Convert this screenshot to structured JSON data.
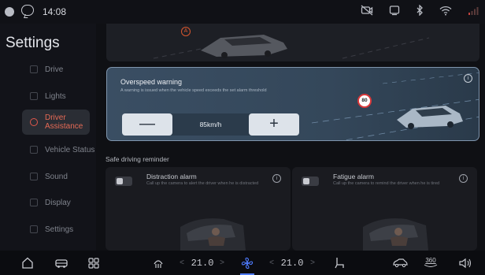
{
  "status_bar": {
    "time": "14:08",
    "icons": [
      "profile-icon",
      "message-icon",
      "camera-off-icon",
      "screen-icon",
      "bluetooth-icon",
      "wifi-icon",
      "signal-icon"
    ]
  },
  "sidebar": {
    "title": "Settings",
    "items": [
      {
        "label": "Drive",
        "active": false
      },
      {
        "label": "Lights",
        "active": false
      },
      {
        "label": "Driver\nAssistance",
        "active": true
      },
      {
        "label": "Vehicle Status",
        "active": false
      },
      {
        "label": "Sound",
        "active": false
      },
      {
        "label": "Display",
        "active": false
      },
      {
        "label": "Settings",
        "active": false
      }
    ]
  },
  "overspeed": {
    "title": "Overspeed warning",
    "description": "A warning is issued when the vehicle speed exceeds the set alarm threshold",
    "value": "85km/h",
    "minus": "—",
    "plus": "+",
    "sign_value": "80"
  },
  "top_card_badge": "A",
  "section_label": "Safe driving reminder",
  "alarms": [
    {
      "title": "Distraction alarm",
      "description": "Call up the camera to alert the driver when he is distracted",
      "enabled": false
    },
    {
      "title": "Fatigue alarm",
      "description": "Call up the camera to remind the driver when he is tired",
      "enabled": false
    }
  ],
  "dock": {
    "left_temp": "21.0",
    "right_temp": "21.0",
    "view_label": "360",
    "chev_left": "<",
    "chev_right": ">"
  },
  "colors": {
    "accent": "#e56a55",
    "card_border": "#7f95ad",
    "fan_active": "#4f7cff"
  }
}
